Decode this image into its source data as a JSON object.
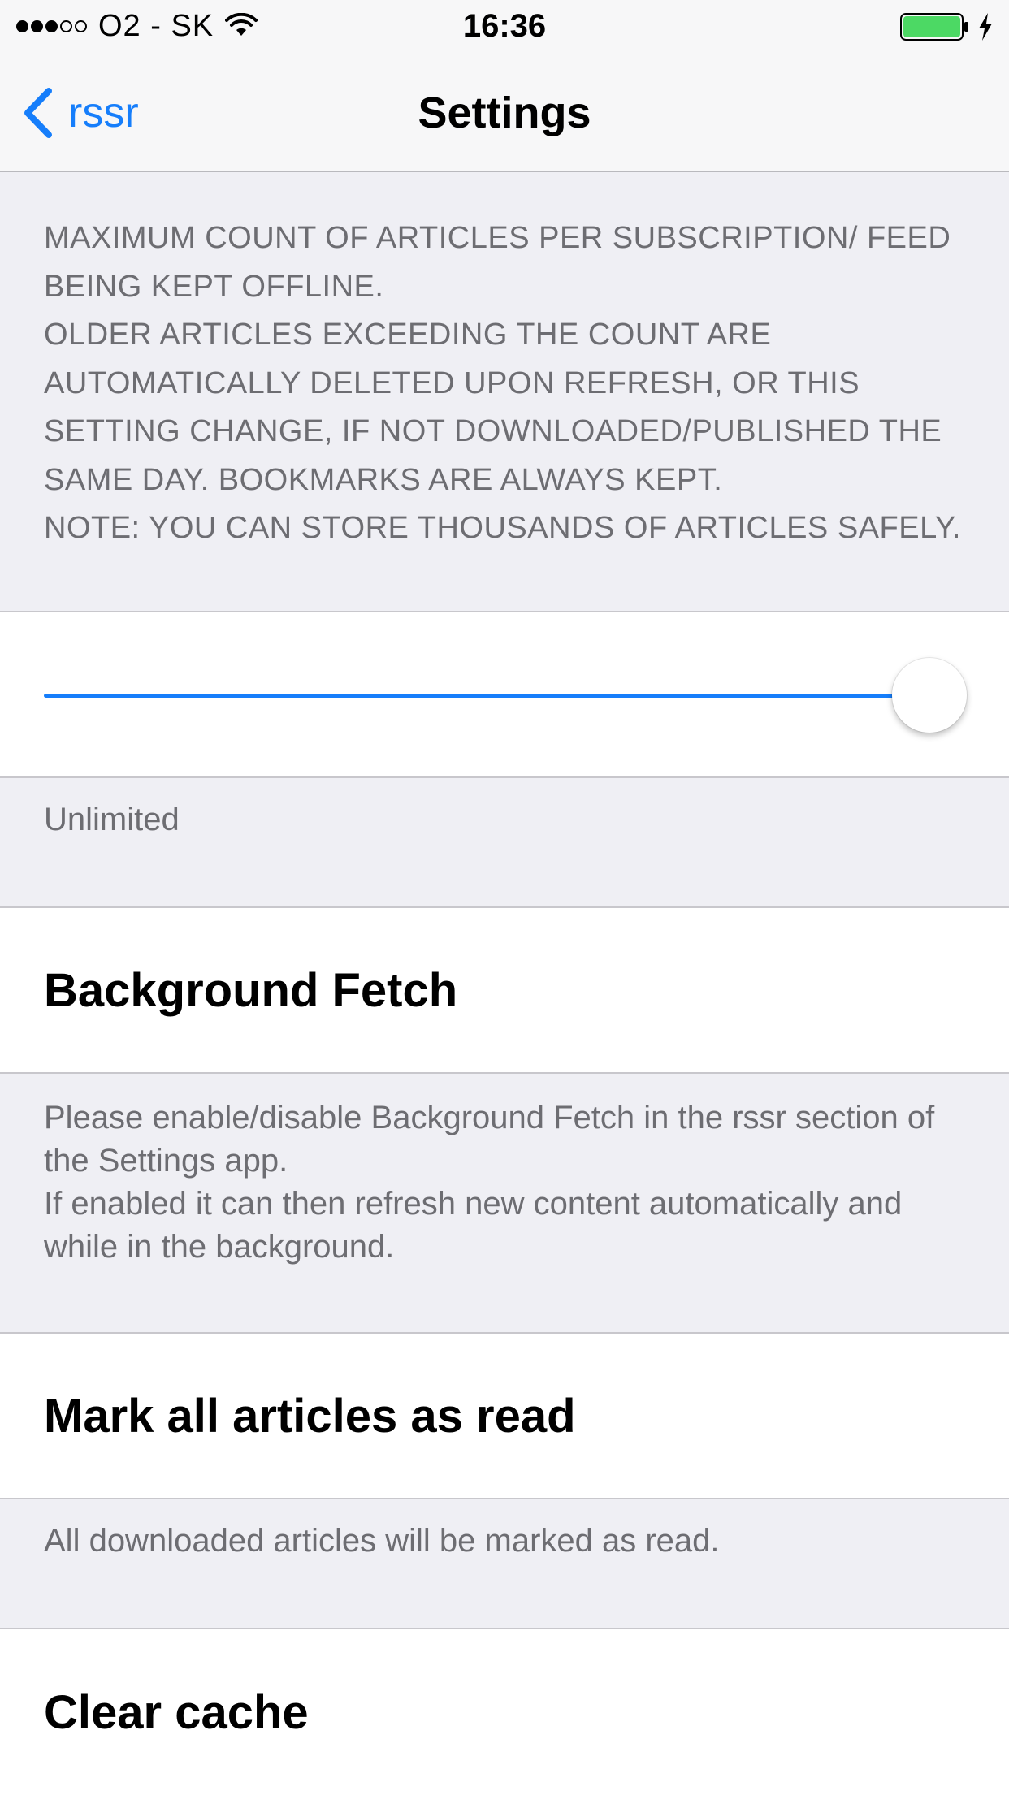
{
  "status_bar": {
    "signal": {
      "filled": 3,
      "empty": 2
    },
    "carrier": "O2 - SK",
    "time": "16:36",
    "battery_color": "#4cd964",
    "icons": [
      "wifi-icon",
      "battery-icon",
      "charging-bolt-icon"
    ]
  },
  "nav": {
    "back_label": "rssr",
    "title": "Settings",
    "accent_color": "#167efb"
  },
  "sections": {
    "offline_count": {
      "header": "Maximum count of articles per subscription/ feed being kept offline.\nOlder articles exceeding the count are automatically deleted upon refresh, or this setting change, if not downloaded/published the same day. Bookmarks are always kept.\nNote: You can store thousands of articles safely.",
      "slider_value": 1.0,
      "footer": "Unlimited"
    },
    "background_fetch": {
      "title": "Background Fetch",
      "footer_line1": "Please enable/disable Background Fetch in the rssr section of the Settings app.",
      "footer_line2": "If enabled it can then refresh new content automatically and while in the background."
    },
    "mark_read": {
      "title": "Mark all articles as read",
      "footer": "All downloaded articles will be marked as read."
    },
    "clear_cache": {
      "title": "Clear cache"
    }
  }
}
